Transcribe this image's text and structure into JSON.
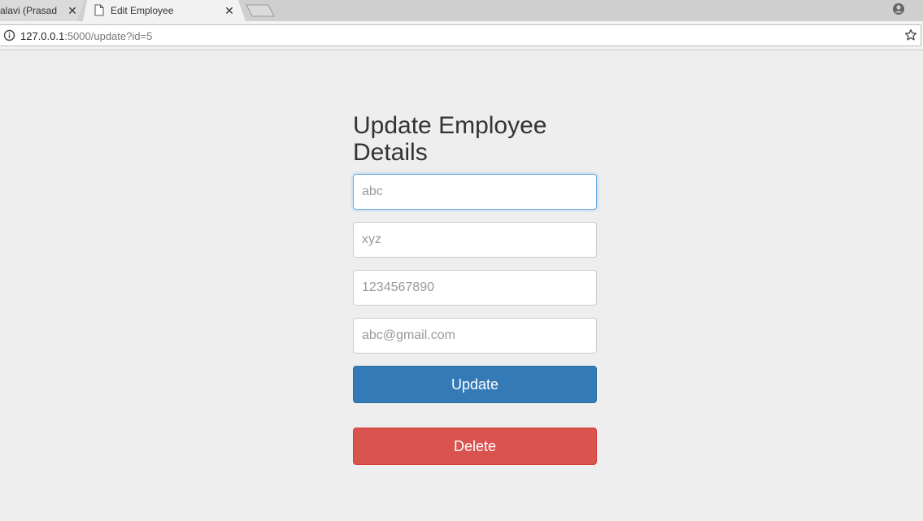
{
  "browser": {
    "tabs": [
      {
        "title": "alavi (Prasad D"
      },
      {
        "title": "Edit Employee"
      }
    ],
    "close_glyph": "✕",
    "url": {
      "host": "127.0.0.1",
      "rest": ":5000/update?id=5"
    },
    "icons": {
      "info": "info-icon",
      "star": "star-icon",
      "profile": "profile-icon",
      "page": "page-icon",
      "new_tab": "new-tab-icon"
    }
  },
  "page": {
    "heading_line1": "Update Employee",
    "heading_line2": "Details",
    "fields": [
      {
        "name": "first-name",
        "placeholder": "abc",
        "value": ""
      },
      {
        "name": "last-name",
        "placeholder": "xyz",
        "value": ""
      },
      {
        "name": "phone",
        "placeholder": "1234567890",
        "value": ""
      },
      {
        "name": "email",
        "placeholder": "abc@gmail.com",
        "value": ""
      }
    ],
    "update_label": "Update",
    "delete_label": "Delete"
  },
  "colors": {
    "primary": "#337ab7",
    "danger": "#d9534f",
    "background": "#eeeeee",
    "focus": "#66afe9"
  }
}
